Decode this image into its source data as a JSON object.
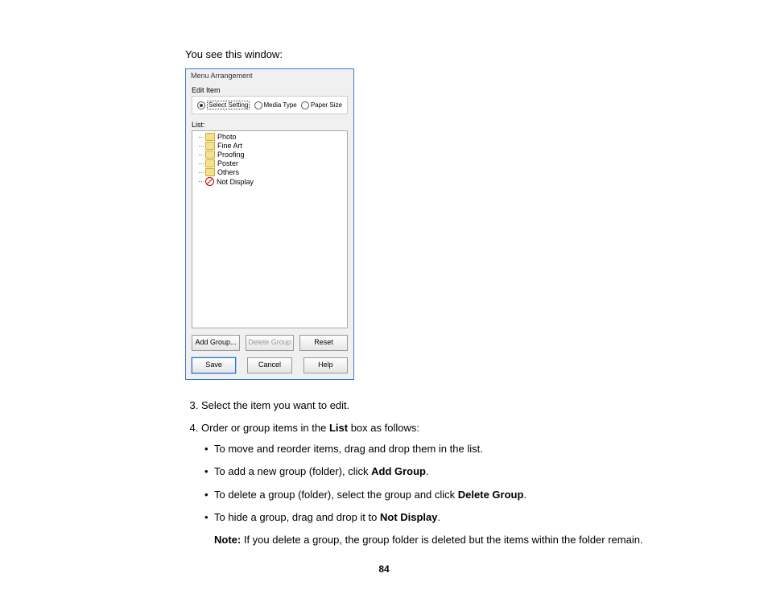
{
  "intro": "You see this window:",
  "dialog": {
    "title": "Menu Arrangement",
    "edit_item_label": "Edit Item",
    "radios": {
      "select_setting": "Select Setting",
      "media_type": "Media Type",
      "paper_size": "Paper Size"
    },
    "list_label": "List:",
    "list_items": {
      "photo": "Photo",
      "fine_art": "Fine Art",
      "proofing": "Proofing",
      "poster": "Poster",
      "others": "Others",
      "not_display": "Not Display"
    },
    "buttons": {
      "add_group": "Add Group...",
      "delete_group": "Delete Group",
      "reset": "Reset",
      "save": "Save",
      "cancel": "Cancel",
      "help": "Help"
    }
  },
  "steps": {
    "s3": "Select the item you want to edit.",
    "s4_lead": "Order or group items in the ",
    "s4_bold": "List",
    "s4_tail": " box as follows:",
    "b1": "To move and reorder items, drag and drop them in the list.",
    "b2_lead": "To add a new group (folder), click ",
    "b2_bold": "Add Group",
    "b2_tail": ".",
    "b3_lead": "To delete a group (folder), select the group and click ",
    "b3_bold": "Delete Group",
    "b3_tail": ".",
    "b4_lead": "To hide a group, drag and drop it to ",
    "b4_bold": "Not Display",
    "b4_tail": "."
  },
  "note_lead": "Note:",
  "note_body": " If you delete a group, the group folder is deleted but the items within the folder remain.",
  "page_number": "84"
}
